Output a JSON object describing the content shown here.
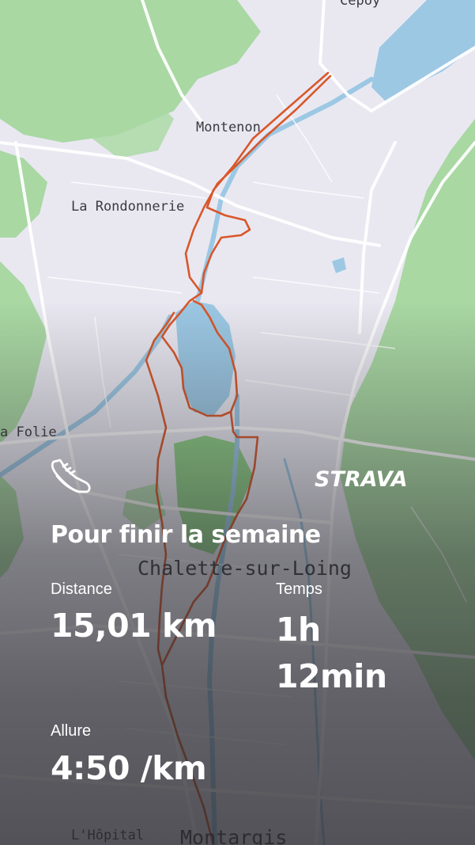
{
  "map": {
    "places": [
      {
        "name": "Cepoy"
      },
      {
        "name": "Montenon"
      },
      {
        "name": "La Rondonnerie"
      },
      {
        "name": "a Folie"
      },
      {
        "name": "Chalette-sur-Loing"
      },
      {
        "name": "L'Hôpital"
      },
      {
        "name": "Montargis"
      }
    ],
    "route_color": "#d9572a"
  },
  "brand": "STRAVA",
  "activity_icon": "running-shoe-icon",
  "title": "Pour finir la semaine",
  "stats": {
    "distance": {
      "label": "Distance",
      "value": "15,01 km"
    },
    "time": {
      "label": "Temps",
      "value": "1h 12min"
    },
    "pace": {
      "label": "Allure",
      "value": "4:50 /km"
    }
  },
  "colors": {
    "text": "#ffffff",
    "water": "#9cc8e4",
    "forest": "#a7d9a0",
    "route": "#d9572a"
  }
}
